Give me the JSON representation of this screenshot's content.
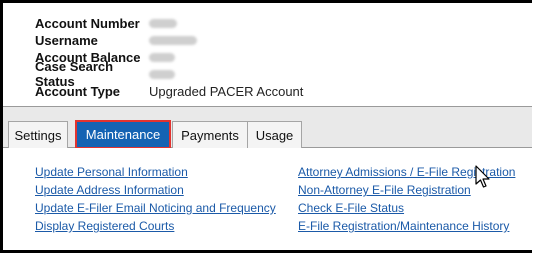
{
  "account": {
    "fields": [
      {
        "label": "Account Number",
        "value": ""
      },
      {
        "label": "Username",
        "value": ""
      },
      {
        "label": "Account Balance",
        "value": ""
      },
      {
        "label": "Case Search Status",
        "value": ""
      },
      {
        "label": "Account Type",
        "value": "Upgraded PACER Account"
      }
    ]
  },
  "tabs": [
    {
      "label": "Settings"
    },
    {
      "label": "Maintenance",
      "active": true
    },
    {
      "label": "Payments"
    },
    {
      "label": "Usage"
    }
  ],
  "maintenance": {
    "left_links": [
      "Update Personal Information",
      "Update Address Information",
      "Update E-Filer Email Noticing and Frequency",
      "Display Registered Courts"
    ],
    "right_links": [
      "Attorney Admissions / E-File Registration",
      "Non-Attorney E-File Registration",
      "Check E-File Status",
      "E-File Registration/Maintenance History"
    ]
  },
  "colors": {
    "active_tab": "#1463b3",
    "active_tab_outline": "#e2332f",
    "link": "#1b5aa8"
  },
  "icons": {
    "cursor": "arrow-cursor-icon"
  }
}
